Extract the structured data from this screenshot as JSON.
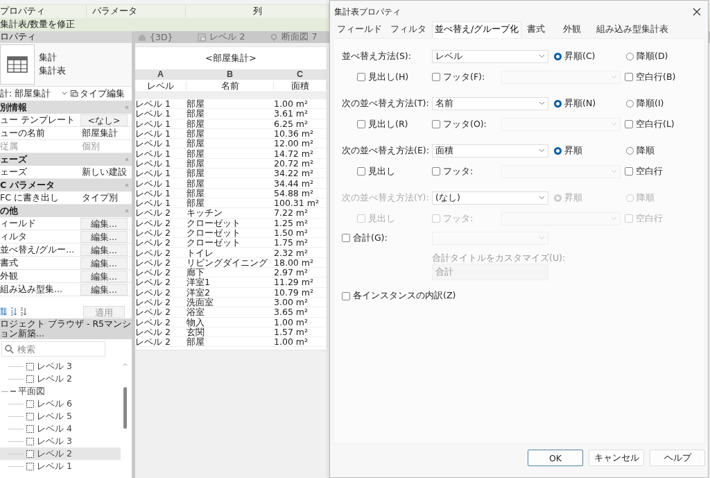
{
  "ribbon": {
    "panels": [
      "プロパティ",
      "パラメータ",
      "列"
    ],
    "context_label": "集計表/数量を修正"
  },
  "properties": {
    "title": "ロパティ",
    "family": "集計",
    "type": "集計表",
    "type_selector": "計: 部屋集計",
    "edit_type_button": "タイプ編集",
    "sections": [
      {
        "title": "別情報",
        "rows": [
          {
            "kind": "button",
            "name": "ュー テンプレート",
            "value": "<なし>",
            "disabled": false
          },
          {
            "kind": "text",
            "name": "ューの名前",
            "value": "部屋集計",
            "disabled": false
          },
          {
            "kind": "text",
            "name": "従属",
            "value": "個別",
            "disabled": true
          }
        ]
      },
      {
        "title": "ェーズ",
        "rows": [
          {
            "kind": "text",
            "name": "ェーズ",
            "value": "新しい建設",
            "disabled": false
          }
        ]
      },
      {
        "title": "C パラメータ",
        "rows": [
          {
            "kind": "text",
            "name": "FC に書き出し",
            "value": "タイプ別",
            "disabled": false
          }
        ]
      },
      {
        "title": "の他",
        "rows": [
          {
            "kind": "button",
            "name": "ィールド",
            "value": "編集...",
            "disabled": false
          },
          {
            "kind": "button",
            "name": "ィルタ",
            "value": "編集...",
            "disabled": false
          },
          {
            "kind": "button",
            "name": "並べ替え/グルー...",
            "value": "編集...",
            "disabled": false
          },
          {
            "kind": "button",
            "name": "書式",
            "value": "編集...",
            "disabled": false
          },
          {
            "kind": "button",
            "name": "外観",
            "value": "編集...",
            "disabled": false
          },
          {
            "kind": "button",
            "name": "組み込み型集...",
            "value": "編集...",
            "disabled": false
          }
        ]
      }
    ],
    "apply_button": "適用"
  },
  "browser": {
    "title": "ロジェクト ブラウザ - R5マンション新築...",
    "search_placeholder": "検索",
    "tree": [
      {
        "children": [
          {
            "label": "レベル 3",
            "selected": false
          },
          {
            "label": "レベル 2",
            "selected": false
          }
        ]
      },
      {
        "label": "平面図",
        "expanded": true,
        "selected": false,
        "children": [
          {
            "label": "レベル 6",
            "selected": false
          },
          {
            "label": "レベル 5",
            "selected": false
          },
          {
            "label": "レベル 4",
            "selected": false
          },
          {
            "label": "レベル 3",
            "selected": false
          },
          {
            "label": "レベル 2",
            "selected": true
          },
          {
            "label": "レベル 1",
            "selected": false
          }
        ]
      }
    ]
  },
  "view_tabs": [
    {
      "kind": "perspective",
      "label": "{3D}"
    },
    {
      "kind": "plan",
      "label": "レベル 2"
    },
    {
      "kind": "section",
      "label": "断面図 7"
    }
  ],
  "schedule": {
    "title": "<部屋集計>",
    "column_letters": [
      "A",
      "B",
      "C"
    ],
    "headings": [
      "レベル",
      "名前",
      "面積"
    ],
    "rows": [
      [
        "レベル 1",
        "部屋",
        "1.00 m²"
      ],
      [
        "レベル 1",
        "部屋",
        "3.61 m²"
      ],
      [
        "レベル 1",
        "部屋",
        "6.25 m²"
      ],
      [
        "レベル 1",
        "部屋",
        "10.36 m²"
      ],
      [
        "レベル 1",
        "部屋",
        "12.00 m²"
      ],
      [
        "レベル 1",
        "部屋",
        "14.72 m²"
      ],
      [
        "レベル 1",
        "部屋",
        "20.72 m²"
      ],
      [
        "レベル 1",
        "部屋",
        "34.22 m²"
      ],
      [
        "レベル 1",
        "部屋",
        "34.44 m²"
      ],
      [
        "レベル 1",
        "部屋",
        "54.88 m²"
      ],
      [
        "レベル 1",
        "部屋",
        "100.31 m²"
      ],
      [
        "レベル 2",
        "キッチン",
        "7.22 m²"
      ],
      [
        "レベル 2",
        "クローゼット",
        "1.25 m²"
      ],
      [
        "レベル 2",
        "クローゼット",
        "1.50 m²"
      ],
      [
        "レベル 2",
        "クローゼット",
        "1.75 m²"
      ],
      [
        "レベル 2",
        "トイレ",
        "2.32 m²"
      ],
      [
        "レベル 2",
        "リビングダイニング",
        "18.00 m²"
      ],
      [
        "レベル 2",
        "廊下",
        "2.97 m²"
      ],
      [
        "レベル 2",
        "洋室1",
        "11.29 m²"
      ],
      [
        "レベル 2",
        "洋室2",
        "10.79 m²"
      ],
      [
        "レベル 2",
        "洗面室",
        "3.00 m²"
      ],
      [
        "レベル 2",
        "浴室",
        "3.65 m²"
      ],
      [
        "レベル 2",
        "物入",
        "1.00 m²"
      ],
      [
        "レベル 2",
        "玄関",
        "1.57 m²"
      ],
      [
        "レベル 2",
        "部屋",
        "1.00 m²"
      ]
    ]
  },
  "dialog": {
    "title": "集計表プロパティ",
    "tabs": [
      {
        "label": "フィールド",
        "selected": false
      },
      {
        "label": "フィルタ",
        "selected": false
      },
      {
        "label": "並べ替え/グループ化",
        "selected": true
      },
      {
        "label": "書式",
        "selected": false
      },
      {
        "label": "外観",
        "selected": false
      },
      {
        "label": "組み込み型集計表",
        "selected": false
      }
    ],
    "sort_groups": [
      {
        "label": "並べ替え方法(S):",
        "value": "レベル",
        "disabled": false,
        "ascending": {
          "label": "昇順(C)",
          "selected": true
        },
        "descending": {
          "label": "降順(D)",
          "selected": false
        },
        "header": {
          "label": "見出し(H)",
          "checked": false
        },
        "footer": {
          "label": "フッタ(F):",
          "checked": false
        },
        "blank_line": {
          "label": "空白行(B)",
          "checked": false
        }
      },
      {
        "label": "次の並べ替え方法(T):",
        "value": "名前",
        "disabled": false,
        "ascending": {
          "label": "昇順(N)",
          "selected": true
        },
        "descending": {
          "label": "降順(I)",
          "selected": false
        },
        "header": {
          "label": "見出し(R)",
          "checked": false
        },
        "footer": {
          "label": "フッタ(O):",
          "checked": false
        },
        "blank_line": {
          "label": "空白行(L)",
          "checked": false
        }
      },
      {
        "label": "次の並べ替え方法(E):",
        "value": "面積",
        "disabled": false,
        "ascending": {
          "label": "昇順",
          "selected": true
        },
        "descending": {
          "label": "降順",
          "selected": false
        },
        "header": {
          "label": "見出し",
          "checked": false
        },
        "footer": {
          "label": "フッタ:",
          "checked": false
        },
        "blank_line": {
          "label": "空白行",
          "checked": false
        }
      },
      {
        "label": "次の並べ替え方法(Y):",
        "value": "(なし)",
        "disabled": true,
        "ascending": {
          "label": "昇順",
          "selected": true
        },
        "descending": {
          "label": "降順",
          "selected": false
        },
        "header": {
          "label": "見出し",
          "checked": false
        },
        "footer": {
          "label": "フッタ:",
          "checked": false
        },
        "blank_line": {
          "label": "空白行",
          "checked": false
        }
      }
    ],
    "grand_total": {
      "label": "合計(G):",
      "checked": false,
      "caption": "合計タイトルをカスタマイズ(U):",
      "title_value": "合計"
    },
    "itemize": {
      "label": "各インスタンスの内訳(Z)",
      "checked": false
    },
    "buttons": [
      {
        "label": "OK",
        "default": true
      },
      {
        "label": "キャンセル",
        "default": false
      },
      {
        "label": "ヘルプ",
        "default": false
      }
    ]
  }
}
